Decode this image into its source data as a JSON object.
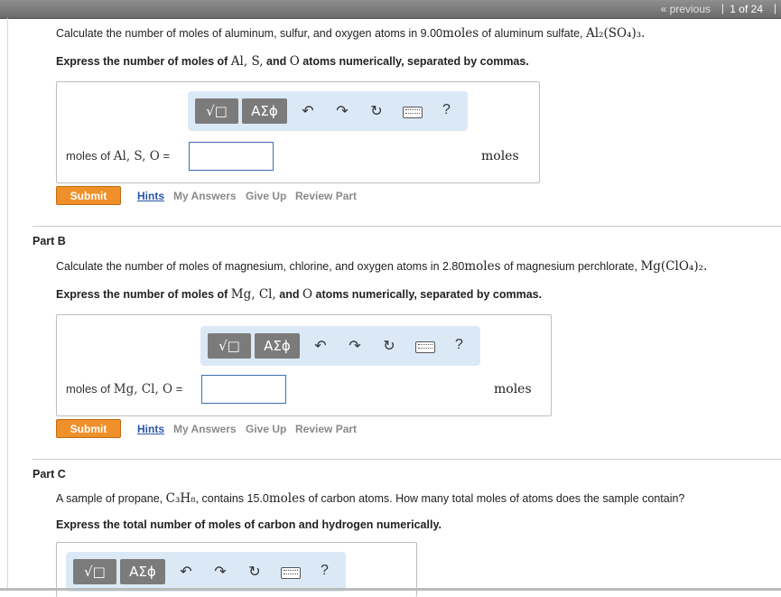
{
  "nav": {
    "previous": "« previous",
    "count": "1 of 24"
  },
  "toolbar": {
    "templates": "√□",
    "symbols": "ΑΣϕ",
    "help": "?"
  },
  "partA": {
    "question_pre": "Calculate the number of moles of aluminum, sulfur, and oxygen atoms in 9.00",
    "question_unit": "moles",
    "question_mid": " of aluminum sulfate, ",
    "formula": "Al₂(SO₄)₃.",
    "instr_pre": "Express the number of moles of ",
    "instr_math": "Al, S,",
    "instr_and": " and ",
    "instr_math2": "O",
    "instr_post": " atoms numerically, separated by commas.",
    "field_label_pre": "moles of ",
    "field_label_math": "Al, S, O",
    "field_label_eq": " =",
    "unit": "moles"
  },
  "partB": {
    "label": "Part B",
    "question_pre": "Calculate the number of moles of magnesium, chlorine, and oxygen atoms in 2.80",
    "question_unit": "moles",
    "question_mid": " of magnesium perchlorate, ",
    "formula": "Mg(ClO₄)₂.",
    "instr_pre": "Express the number of moles of ",
    "instr_math": "Mg, Cl,",
    "instr_and": " and ",
    "instr_math2": "O",
    "instr_post": " atoms numerically, separated by commas.",
    "field_label_pre": "moles of ",
    "field_label_math": "Mg, Cl, O",
    "field_label_eq": " =",
    "unit": "moles"
  },
  "partC": {
    "label": "Part C",
    "question_pre": "A sample of propane, ",
    "formula": "C₃H₈",
    "question_mid": ", contains 15.0",
    "question_unit": "moles",
    "question_post": " of carbon atoms. How many total moles of atoms does the sample contain?",
    "instr": "Express the total number of moles of carbon and hydrogen numerically."
  },
  "actions": {
    "submit": "Submit",
    "hints": "Hints",
    "my_answers": "My Answers",
    "give_up": "Give Up",
    "review_part": "Review Part"
  },
  "colors": {
    "submit": "#f0902a",
    "toolbar_bg": "#dbe9f7",
    "hint_link": "#2a56a8"
  }
}
